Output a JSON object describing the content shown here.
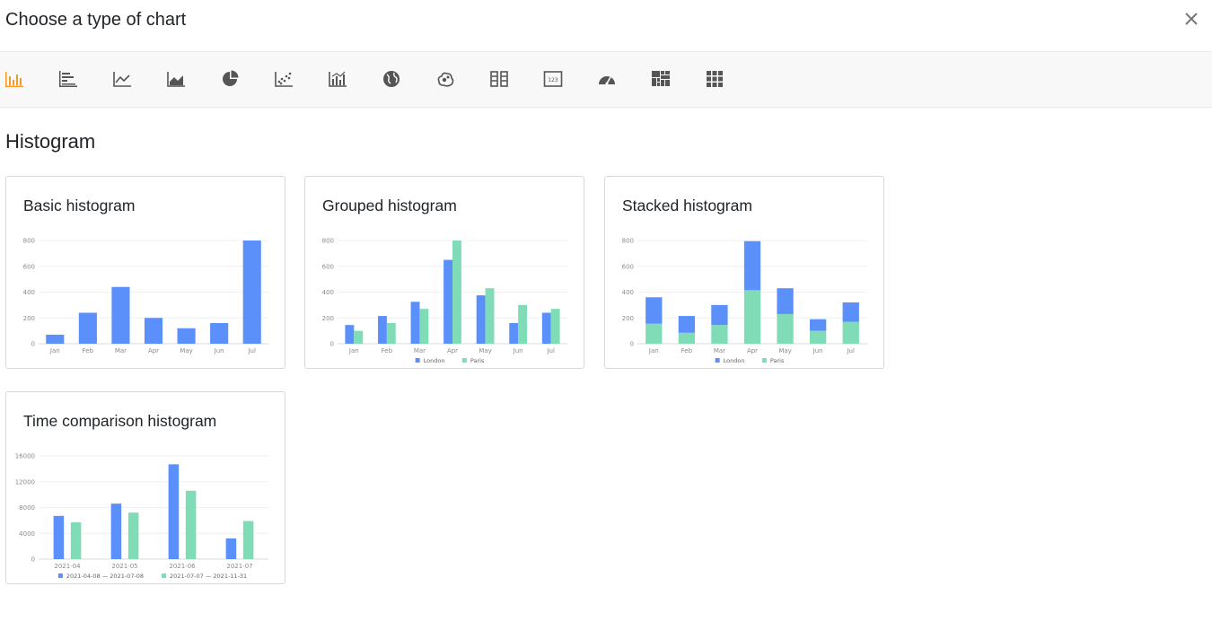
{
  "dialog": {
    "title": "Choose a type of chart",
    "close_icon": "close-icon"
  },
  "toolbar": {
    "items": [
      {
        "icon": "bar-chart-icon",
        "active": true
      },
      {
        "icon": "horizontal-bar-chart-icon",
        "active": false
      },
      {
        "icon": "line-chart-icon",
        "active": false
      },
      {
        "icon": "area-chart-icon",
        "active": false
      },
      {
        "icon": "pie-chart-icon",
        "active": false
      },
      {
        "icon": "scatter-chart-icon",
        "active": false
      },
      {
        "icon": "combo-chart-icon",
        "active": false
      },
      {
        "icon": "map-globe-icon",
        "active": false
      },
      {
        "icon": "heat-map-icon",
        "active": false
      },
      {
        "icon": "column-table-icon",
        "active": false
      },
      {
        "icon": "number-card-icon",
        "active": false
      },
      {
        "icon": "gauge-icon",
        "active": false
      },
      {
        "icon": "treemap-icon",
        "active": false
      },
      {
        "icon": "pivot-grid-icon",
        "active": false
      }
    ],
    "active_color": "#f59a23",
    "icon_color": "#555555"
  },
  "section": {
    "title": "Histogram"
  },
  "colors": {
    "blue": "#5b8ff9",
    "green": "#7fdcb6"
  },
  "cards": [
    {
      "title": "Basic histogram"
    },
    {
      "title": "Grouped histogram"
    },
    {
      "title": "Stacked histogram"
    },
    {
      "title": "Time comparison histogram"
    }
  ],
  "chart_data": [
    {
      "type": "bar",
      "categories": [
        "Jan",
        "Feb",
        "Mar",
        "Apr",
        "May",
        "Jun",
        "Jul"
      ],
      "series": [
        {
          "values": [
            70,
            240,
            440,
            200,
            120,
            160,
            800
          ]
        }
      ],
      "yticks": [
        "0",
        "200",
        "400",
        "600",
        "800"
      ],
      "ylim": [
        0,
        800
      ]
    },
    {
      "type": "bar",
      "mode": "grouped",
      "categories": [
        "Jan",
        "Feb",
        "Mar",
        "Apr",
        "May",
        "Jun",
        "Jul"
      ],
      "series": [
        {
          "name": "London",
          "values": [
            145,
            215,
            325,
            650,
            375,
            160,
            240
          ]
        },
        {
          "name": "Paris",
          "values": [
            100,
            160,
            270,
            800,
            430,
            300,
            270
          ]
        }
      ],
      "yticks": [
        "0",
        "200",
        "400",
        "600",
        "800"
      ],
      "ylim": [
        0,
        800
      ]
    },
    {
      "type": "bar",
      "mode": "stacked",
      "categories": [
        "Jan",
        "Feb",
        "Mar",
        "Apr",
        "May",
        "Jun",
        "Jul"
      ],
      "series": [
        {
          "name": "London",
          "values": [
            205,
            130,
            155,
            380,
            200,
            90,
            150
          ]
        },
        {
          "name": "Paris",
          "values": [
            155,
            85,
            145,
            415,
            230,
            100,
            170
          ]
        }
      ],
      "yticks": [
        "0",
        "200",
        "400",
        "600",
        "800"
      ],
      "ylim": [
        0,
        800
      ]
    },
    {
      "type": "bar",
      "mode": "grouped",
      "categories": [
        "2021-04",
        "2021-05",
        "2021-06",
        "2021-07"
      ],
      "series": [
        {
          "name": "2021-04-08 — 2021-07-08",
          "values": [
            6700,
            8600,
            14700,
            3200
          ]
        },
        {
          "name": "2021-07-07 — 2021-11-31",
          "values": [
            5700,
            7200,
            10600,
            5900
          ]
        }
      ],
      "yticks": [
        "0",
        "4000",
        "8000",
        "12000",
        "16000"
      ],
      "ylim": [
        0,
        16000
      ]
    }
  ]
}
